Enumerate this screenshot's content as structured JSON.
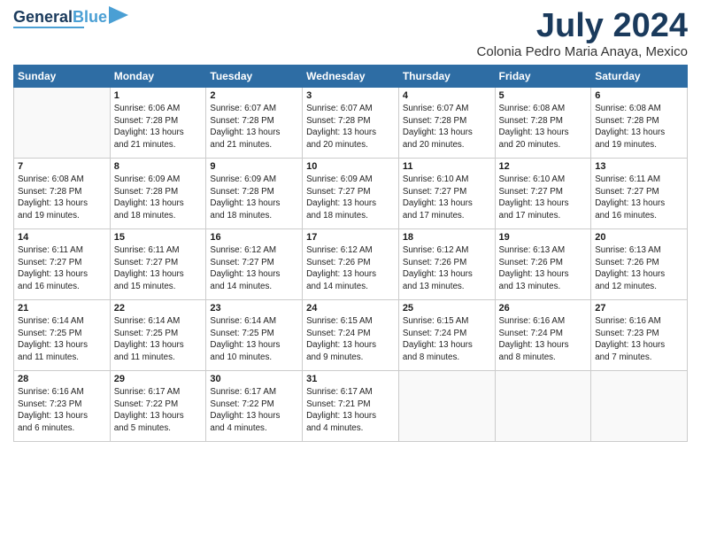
{
  "header": {
    "logo_line1": "General",
    "logo_line2": "Blue",
    "month_title": "July 2024",
    "location": "Colonia Pedro Maria Anaya, Mexico"
  },
  "days_of_week": [
    "Sunday",
    "Monday",
    "Tuesday",
    "Wednesday",
    "Thursday",
    "Friday",
    "Saturday"
  ],
  "weeks": [
    [
      {
        "date": "",
        "detail": ""
      },
      {
        "date": "1",
        "detail": "Sunrise: 6:06 AM\nSunset: 7:28 PM\nDaylight: 13 hours\nand 21 minutes."
      },
      {
        "date": "2",
        "detail": "Sunrise: 6:07 AM\nSunset: 7:28 PM\nDaylight: 13 hours\nand 21 minutes."
      },
      {
        "date": "3",
        "detail": "Sunrise: 6:07 AM\nSunset: 7:28 PM\nDaylight: 13 hours\nand 20 minutes."
      },
      {
        "date": "4",
        "detail": "Sunrise: 6:07 AM\nSunset: 7:28 PM\nDaylight: 13 hours\nand 20 minutes."
      },
      {
        "date": "5",
        "detail": "Sunrise: 6:08 AM\nSunset: 7:28 PM\nDaylight: 13 hours\nand 20 minutes."
      },
      {
        "date": "6",
        "detail": "Sunrise: 6:08 AM\nSunset: 7:28 PM\nDaylight: 13 hours\nand 19 minutes."
      }
    ],
    [
      {
        "date": "7",
        "detail": "Sunrise: 6:08 AM\nSunset: 7:28 PM\nDaylight: 13 hours\nand 19 minutes."
      },
      {
        "date": "8",
        "detail": "Sunrise: 6:09 AM\nSunset: 7:28 PM\nDaylight: 13 hours\nand 18 minutes."
      },
      {
        "date": "9",
        "detail": "Sunrise: 6:09 AM\nSunset: 7:28 PM\nDaylight: 13 hours\nand 18 minutes."
      },
      {
        "date": "10",
        "detail": "Sunrise: 6:09 AM\nSunset: 7:27 PM\nDaylight: 13 hours\nand 18 minutes."
      },
      {
        "date": "11",
        "detail": "Sunrise: 6:10 AM\nSunset: 7:27 PM\nDaylight: 13 hours\nand 17 minutes."
      },
      {
        "date": "12",
        "detail": "Sunrise: 6:10 AM\nSunset: 7:27 PM\nDaylight: 13 hours\nand 17 minutes."
      },
      {
        "date": "13",
        "detail": "Sunrise: 6:11 AM\nSunset: 7:27 PM\nDaylight: 13 hours\nand 16 minutes."
      }
    ],
    [
      {
        "date": "14",
        "detail": "Sunrise: 6:11 AM\nSunset: 7:27 PM\nDaylight: 13 hours\nand 16 minutes."
      },
      {
        "date": "15",
        "detail": "Sunrise: 6:11 AM\nSunset: 7:27 PM\nDaylight: 13 hours\nand 15 minutes."
      },
      {
        "date": "16",
        "detail": "Sunrise: 6:12 AM\nSunset: 7:27 PM\nDaylight: 13 hours\nand 14 minutes."
      },
      {
        "date": "17",
        "detail": "Sunrise: 6:12 AM\nSunset: 7:26 PM\nDaylight: 13 hours\nand 14 minutes."
      },
      {
        "date": "18",
        "detail": "Sunrise: 6:12 AM\nSunset: 7:26 PM\nDaylight: 13 hours\nand 13 minutes."
      },
      {
        "date": "19",
        "detail": "Sunrise: 6:13 AM\nSunset: 7:26 PM\nDaylight: 13 hours\nand 13 minutes."
      },
      {
        "date": "20",
        "detail": "Sunrise: 6:13 AM\nSunset: 7:26 PM\nDaylight: 13 hours\nand 12 minutes."
      }
    ],
    [
      {
        "date": "21",
        "detail": "Sunrise: 6:14 AM\nSunset: 7:25 PM\nDaylight: 13 hours\nand 11 minutes."
      },
      {
        "date": "22",
        "detail": "Sunrise: 6:14 AM\nSunset: 7:25 PM\nDaylight: 13 hours\nand 11 minutes."
      },
      {
        "date": "23",
        "detail": "Sunrise: 6:14 AM\nSunset: 7:25 PM\nDaylight: 13 hours\nand 10 minutes."
      },
      {
        "date": "24",
        "detail": "Sunrise: 6:15 AM\nSunset: 7:24 PM\nDaylight: 13 hours\nand 9 minutes."
      },
      {
        "date": "25",
        "detail": "Sunrise: 6:15 AM\nSunset: 7:24 PM\nDaylight: 13 hours\nand 8 minutes."
      },
      {
        "date": "26",
        "detail": "Sunrise: 6:16 AM\nSunset: 7:24 PM\nDaylight: 13 hours\nand 8 minutes."
      },
      {
        "date": "27",
        "detail": "Sunrise: 6:16 AM\nSunset: 7:23 PM\nDaylight: 13 hours\nand 7 minutes."
      }
    ],
    [
      {
        "date": "28",
        "detail": "Sunrise: 6:16 AM\nSunset: 7:23 PM\nDaylight: 13 hours\nand 6 minutes."
      },
      {
        "date": "29",
        "detail": "Sunrise: 6:17 AM\nSunset: 7:22 PM\nDaylight: 13 hours\nand 5 minutes."
      },
      {
        "date": "30",
        "detail": "Sunrise: 6:17 AM\nSunset: 7:22 PM\nDaylight: 13 hours\nand 4 minutes."
      },
      {
        "date": "31",
        "detail": "Sunrise: 6:17 AM\nSunset: 7:21 PM\nDaylight: 13 hours\nand 4 minutes."
      },
      {
        "date": "",
        "detail": ""
      },
      {
        "date": "",
        "detail": ""
      },
      {
        "date": "",
        "detail": ""
      }
    ]
  ]
}
